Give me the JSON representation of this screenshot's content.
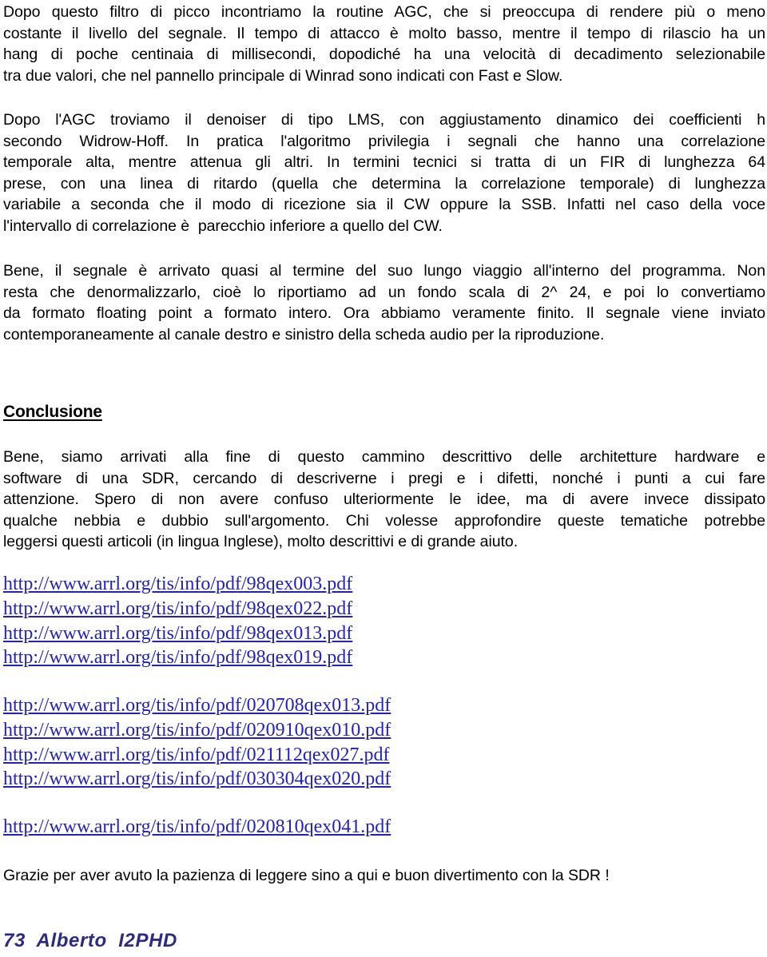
{
  "document": {
    "language": "it",
    "body_text_color": "#000000",
    "link_color": "#2222bb",
    "signature_color": "#2b2b80"
  },
  "paragraphs": {
    "p1": {
      "lines": [
        "Dopo questo filtro di picco incontriamo la routine AGC, che si preoccupa di rendere più  o meno",
        "costante il livello del segnale. Il tempo di attacco è  molto basso, mentre il tempo di rilascio ha un",
        "hang di poche centinaia di millisecondi, dopodiché ha una velocità di decadimento selezionabile",
        "tra due valori, che nel pannello principale di Winrad sono indicati con Fast e Slow."
      ]
    },
    "p2": {
      "lines": [
        "Dopo l'AGC troviamo il denoiser di tipo LMS,  con  aggiustamento  dinamico  dei coefficienti h",
        "secondo Widrow-Hoff.  In pratica l'algoritmo privilegia i segnali che hanno  una  correlazione",
        "temporale alta, mentre attenua gli altri.  In termini tecnici si tratta di un FIR di lunghezza 64",
        "prese, con una linea di ritardo (quella che determina la correlazione temporale) di lunghezza",
        "variabile a seconda che il modo di ricezione sia il CW oppure la SSB.  Infatti nel caso della voce",
        "l'intervallo di correlazione è  parecchio inferiore a quello del CW."
      ]
    },
    "p3": {
      "lines": [
        "Bene, il segnale è  arrivato quasi al termine del suo lungo viaggio all'interno del programma.  Non",
        "resta  che  denormalizzarlo, cioè  lo riportiamo ad un fondo scala di 2^ 24, e poi lo convertiamo",
        "da formato floating point a formato intero. Ora abbiamo veramente finito.  Il segnale viene inviato",
        "contemporaneamente al canale destro e sinistro della scheda audio per la riproduzione."
      ]
    },
    "conclusion_body": {
      "lines": [
        "Bene, siamo arrivati alla fine di questo cammino descrittivo delle architetture hardware e",
        "software di una SDR, cercando di descriverne i pregi e i difetti, nonché i punti a cui fare",
        "attenzione. Spero di non avere confuso ulteriormente le idee, ma di avere invece dissipato",
        "qualche nebbia e dubbio sull'argomento. Chi volesse approfondire queste tematiche potrebbe",
        "leggersi questi articoli (in lingua Inglese), molto descrittivi e di grande aiuto."
      ]
    },
    "thanks": {
      "lines": [
        "Grazie per aver avuto la pazienza di leggere sino a qui e buon divertimento con la SDR !"
      ]
    }
  },
  "headings": {
    "conclusione": "Conclusione"
  },
  "links": {
    "group1": [
      "http://www.arrl.org/tis/info/pdf/98qex003.pdf",
      "http://www.arrl.org/tis/info/pdf/98qex022.pdf",
      "http://www.arrl.org/tis/info/pdf/98qex013.pdf",
      "http://www.arrl.org/tis/info/pdf/98qex019.pdf"
    ],
    "group2": [
      "http://www.arrl.org/tis/info/pdf/020708qex013.pdf",
      "http://www.arrl.org/tis/info/pdf/020910qex010.pdf",
      "http://www.arrl.org/tis/info/pdf/021112qex027.pdf",
      "http://www.arrl.org/tis/info/pdf/030304qex020.pdf"
    ],
    "group3": [
      "http://www.arrl.org/tis/info/pdf/020810qex041.pdf"
    ]
  },
  "signature": "73  Alberto  I2PHD"
}
